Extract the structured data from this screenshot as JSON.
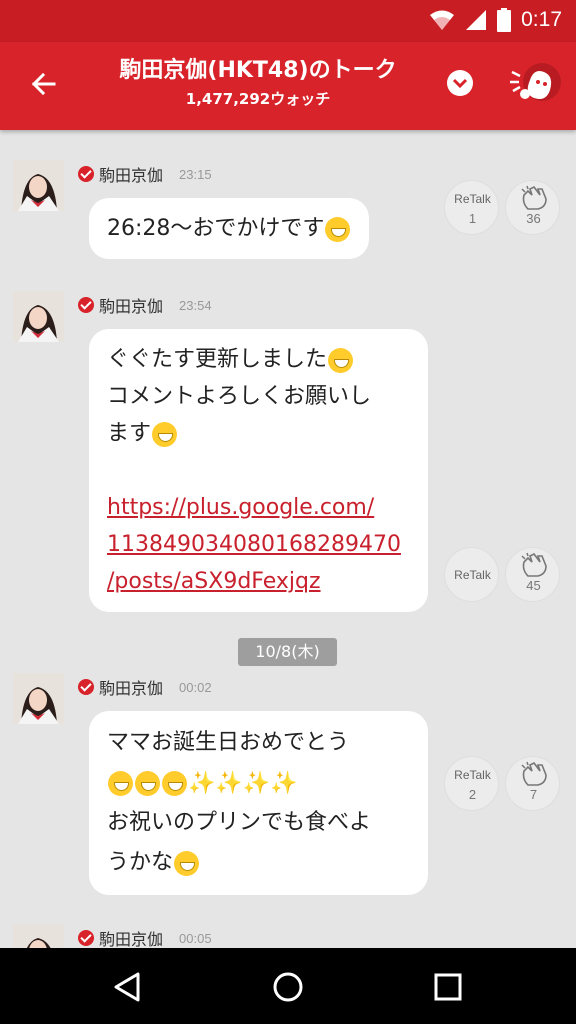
{
  "status_bar": {
    "time": "0:17"
  },
  "header": {
    "title": "駒田京伽(HKT48)のトーク",
    "watch_count": "1,477,292ウォッチ"
  },
  "messages": [
    {
      "sender": "駒田京伽",
      "time": "23:15",
      "text": "26:28〜おでかけです",
      "retalk_label": "ReTalk",
      "retalk_count": "1",
      "clap_count": "36"
    },
    {
      "sender": "駒田京伽",
      "time": "23:54",
      "line1": "ぐぐたす更新しました",
      "line2": "コメントよろしくお願いし",
      "line3": "ます",
      "link_line1": "https://plus.google.com/",
      "link_line2": "113849034080168289470",
      "link_line3": "/posts/aSX9dFexjqz",
      "retalk_label": "ReTalk",
      "clap_count": "45"
    },
    {
      "sender": "駒田京伽",
      "time": "00:02",
      "line1": "ママお誕生日おめでとう",
      "line3": "お祝いのプリンでも食べよ",
      "line4": "うかな",
      "retalk_label": "ReTalk",
      "retalk_count": "2",
      "clap_count": "7"
    },
    {
      "sender": "駒田京伽",
      "time": "00:05"
    }
  ],
  "date_separator": "10/8(木)",
  "colors": {
    "brand_red": "#d8232a",
    "link_red": "#c8202c",
    "background": "#e5e5e5"
  },
  "icons": {
    "back": "arrow-left-icon",
    "dropdown": "chevron-down-icon",
    "mascot": "mascot-icon",
    "clap": "clap-icon",
    "nav_back": "triangle-back-icon",
    "nav_home": "circle-home-icon",
    "nav_recents": "square-recents-icon"
  }
}
